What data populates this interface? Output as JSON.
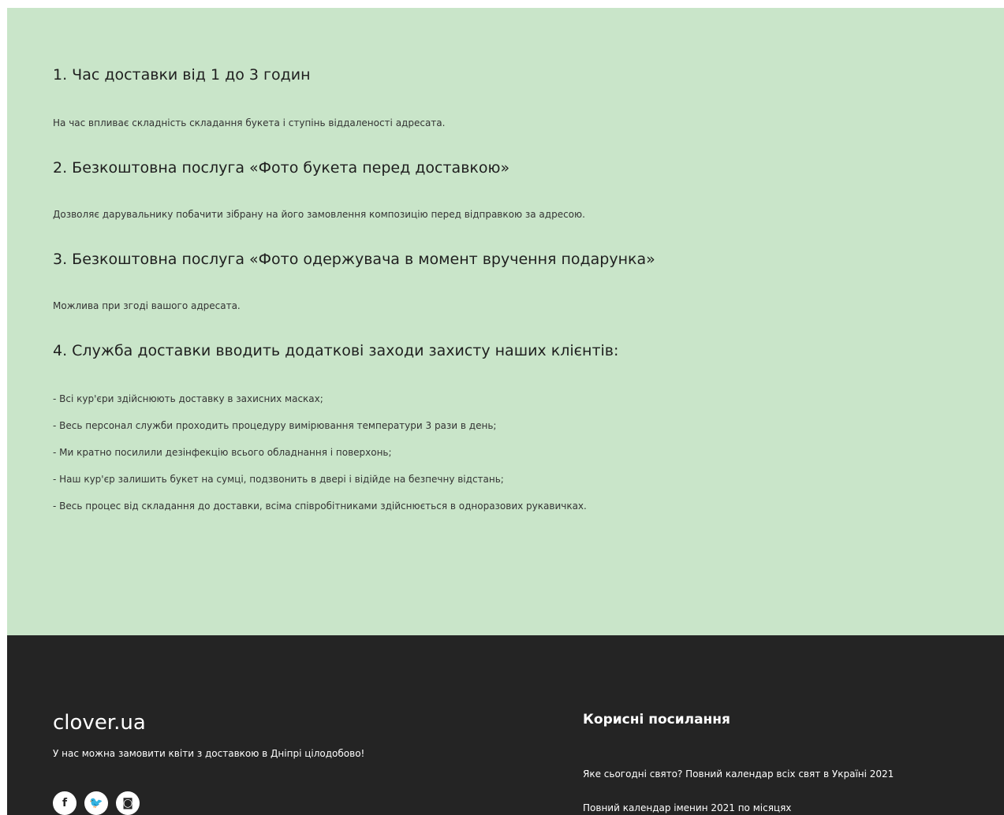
{
  "sections": [
    {
      "title": "1. Час доставки від 1 до 3 годин",
      "text": "На час впливає складність складання букета і ступінь віддаленості адресата."
    },
    {
      "title": "2. Безкоштовна послуга «Фото букета перед доставкою»",
      "text": "Дозволяє дарувальнику побачити зібрану на його замовлення композицію перед відправкою за адресою."
    },
    {
      "title": "3. Безкоштовна послуга «Фото одержувача в момент вручення подарунка»",
      "text": "Можлива при згоді вашого адресата."
    },
    {
      "title": "4. Служба доставки вводить додаткові заходи захисту наших клієнтів:"
    }
  ],
  "measures": [
    "- Всі кур'єри здійснюють доставку в захисних масках;",
    "- Весь персонал служби проходить процедуру вимірювання температури 3 рази в день;",
    "- Ми кратно посилили дезінфекцію всього обладнання і поверхонь;",
    "- Наш кур'єр залишить букет на сумці, подзвонить в двері і відійде на безпечну відстань;",
    "- Весь процес від складання до доставки, всіма співробітниками здійснюється в одноразових рукавичках."
  ],
  "footer": {
    "brand": "clover.ua",
    "tagline": "У нас можна замовити квіти з доставкою в Дніпрі цілодобово!",
    "social": [
      {
        "icon": "facebook-icon",
        "glyph": "f"
      },
      {
        "icon": "twitter-icon",
        "glyph": "🐦"
      },
      {
        "icon": "instagram-icon",
        "glyph": "◙"
      }
    ],
    "links_title": "Корисні посилання",
    "links": [
      "Яке сьогодні свято? Повний календар всіх свят в Україні 2021",
      "Повний календар іменин 2021 по місяцях"
    ]
  },
  "colors": {
    "content_bg": "#c9e5c9",
    "footer_bg": "#242424"
  }
}
